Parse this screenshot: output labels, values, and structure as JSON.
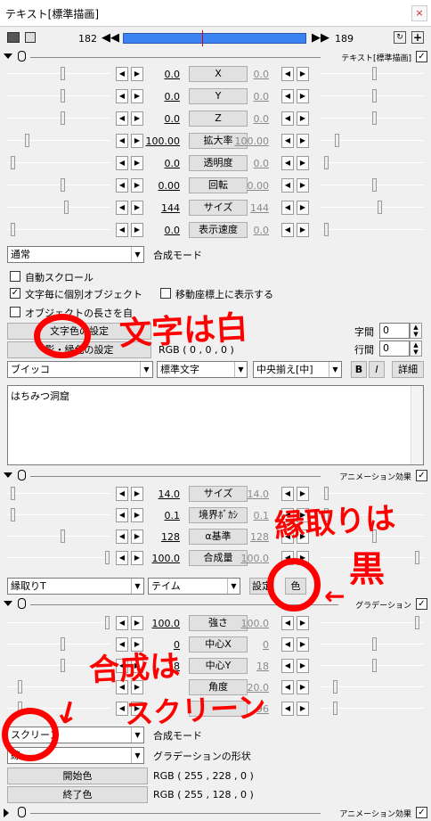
{
  "window": {
    "title": "テキスト[標準描画]",
    "close": "×"
  },
  "frames": {
    "start": "182",
    "end": "189"
  },
  "text_section": {
    "label": "テキスト[標準描画]",
    "checked": "✓"
  },
  "params1": [
    {
      "name": "X",
      "left": "0.0",
      "right": "0.0"
    },
    {
      "name": "Y",
      "left": "0.0",
      "right": "0.0"
    },
    {
      "name": "Z",
      "left": "0.0",
      "right": "0.0"
    },
    {
      "name": "拡大率",
      "left": "100.00",
      "right": "100.00"
    },
    {
      "name": "透明度",
      "left": "0.0",
      "right": "0.0"
    },
    {
      "name": "回転",
      "left": "0.00",
      "right": "0.00"
    },
    {
      "name": "サイズ",
      "left": "144",
      "right": "144"
    },
    {
      "name": "表示速度",
      "left": "0.0",
      "right": "0.0"
    }
  ],
  "blend": {
    "value": "通常",
    "label": "合成モード"
  },
  "options": {
    "auto_scroll": "自動スクロール",
    "per_char": "文字毎に個別オブジェクト",
    "move_coord": "移動座標上に表示する",
    "obj_length": "オブジェクトの長さを自",
    "char_color_btn": "文字色の設定",
    "edge_color_btn": "影・縁色の設定",
    "edge_rgb": "RGB ( 0 , 0 , 0 )",
    "char_spacing_label": "字間",
    "char_spacing": "0",
    "line_spacing_label": "行間",
    "line_spacing": "0"
  },
  "font_row": {
    "font": "ブイッコ",
    "style": "標準文字",
    "align": "中央揃え[中]",
    "bold": "B",
    "italic": "I",
    "detail": "詳細"
  },
  "content_text": "はちみつ洞窟",
  "anim1": {
    "label": "アニメーション効果",
    "checked": "✓"
  },
  "params2": [
    {
      "name": "サイズ",
      "left": "14.0",
      "right": "14.0"
    },
    {
      "name": "境界ﾎﾞｶｼ",
      "left": "0.1",
      "right": "0.1"
    },
    {
      "name": "α基準",
      "left": "128",
      "right": "128"
    },
    {
      "name": "合成量",
      "left": "100.0",
      "right": "100.0"
    }
  ],
  "edge_row": {
    "effect": "縁取りT",
    "pattern": "テイム",
    "settings_btn": "設定",
    "color_btn": "色"
  },
  "grad_section": {
    "label": "グラデーション",
    "checked": "✓"
  },
  "params3": [
    {
      "name": "強さ",
      "left": "100.0",
      "right": "100.0"
    },
    {
      "name": "中心X",
      "left": "0",
      "right": "0"
    },
    {
      "name": "中心Y",
      "left": "18",
      "right": "18"
    },
    {
      "name": "角度",
      "left": "",
      "right": "20.0"
    },
    {
      "name": "",
      "left": "",
      "right": "96"
    }
  ],
  "grad_blend": {
    "value": "スクリーン",
    "label": "合成モード"
  },
  "grad_shape": {
    "value": "線",
    "label": "グラデーションの形状"
  },
  "grad_colors": {
    "start_btn": "開始色",
    "start_rgb": "RGB ( 255 , 228 , 0 )",
    "end_btn": "終了色",
    "end_rgb": "RGB ( 255 , 128 , 0 )"
  },
  "anim2": {
    "label": "アニメーション効果",
    "checked": "✓"
  },
  "annotations": {
    "white": "文字は白",
    "edge": "縁取りは",
    "black": "黒",
    "blend": "合成は",
    "screen": "スクリーン"
  }
}
